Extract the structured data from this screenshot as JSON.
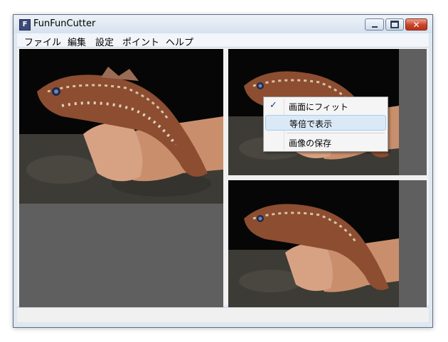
{
  "window": {
    "title": "FunFunCutter",
    "icon": "F"
  },
  "menu": [
    "ファイル",
    "編集",
    "設定",
    "ポイント",
    "ヘルプ"
  ],
  "context_menu": {
    "items": [
      {
        "label": "画面にフィット",
        "checked": true
      },
      {
        "label": "等倍で表示",
        "highlighted": true
      },
      {
        "label": "画像の保存"
      }
    ]
  },
  "colors": {
    "pane_bg": "#5f5f5f",
    "menu_highlight": "#dbe9f7",
    "close_button": "#c9412a"
  },
  "icons": [
    "app-icon",
    "minimize-icon",
    "maximize-icon",
    "close-icon",
    "check-icon"
  ]
}
